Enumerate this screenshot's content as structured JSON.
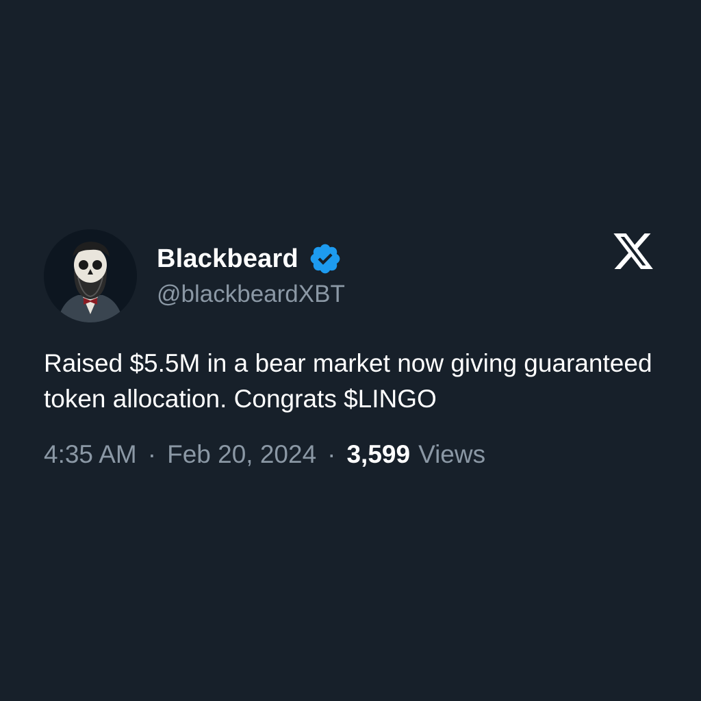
{
  "tweet": {
    "author": {
      "display_name": "Blackbeard",
      "handle": "@blackbeardXBT",
      "verified": true,
      "verified_color": "#1d9bf0",
      "avatar_icon": "skull-bearded-man-avatar"
    },
    "brand_icon": "x-logo-icon",
    "text": "Raised $5.5M in a bear market now giving guaranteed token allocation. Congrats $LINGO",
    "time": "4:35 AM",
    "separator": "·",
    "date": "Feb 20, 2024",
    "views_count": "3,599",
    "views_label": "Views"
  },
  "colors": {
    "background": "#17202a",
    "primary_text": "#ffffff",
    "secondary_text": "#8b98a5"
  }
}
